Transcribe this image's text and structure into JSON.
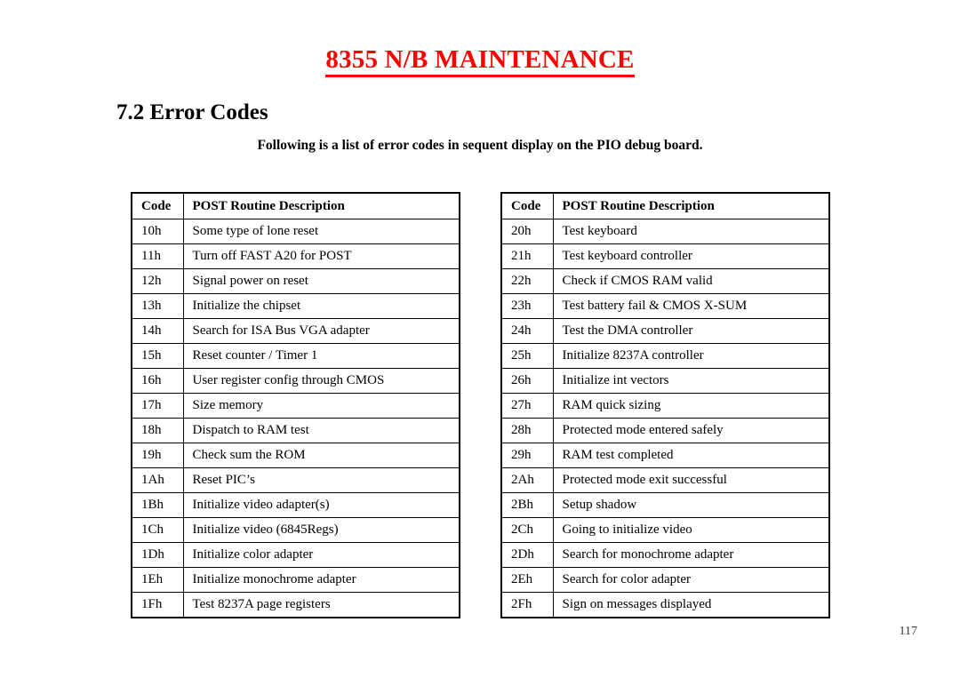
{
  "document": {
    "title": "8355 N/B MAINTENANCE",
    "title_color": "#ff0000",
    "section_heading": "7.2 Error Codes",
    "intro_text": "Following is a list of error codes in sequent display on the PIO debug board.",
    "page_number": "117"
  },
  "tables": {
    "left": {
      "headers": {
        "code": "Code",
        "description": "POST Routine Description"
      },
      "rows": [
        {
          "code": "10h",
          "description": "Some type of lone reset"
        },
        {
          "code": "11h",
          "description": "Turn off FAST A20 for POST"
        },
        {
          "code": "12h",
          "description": "Signal power on reset"
        },
        {
          "code": "13h",
          "description": "Initialize the chipset"
        },
        {
          "code": "14h",
          "description": "Search for ISA Bus VGA adapter"
        },
        {
          "code": "15h",
          "description": "Reset counter / Timer 1"
        },
        {
          "code": "16h",
          "description": "User register config through CMOS"
        },
        {
          "code": "17h",
          "description": "Size memory"
        },
        {
          "code": "18h",
          "description": "Dispatch to RAM test"
        },
        {
          "code": "19h",
          "description": "Check sum the ROM"
        },
        {
          "code": "1Ah",
          "description": "Reset PIC’s"
        },
        {
          "code": "1Bh",
          "description": "Initialize video adapter(s)"
        },
        {
          "code": "1Ch",
          "description": "Initialize video (6845Regs)"
        },
        {
          "code": "1Dh",
          "description": "Initialize color adapter"
        },
        {
          "code": "1Eh",
          "description": "Initialize monochrome adapter"
        },
        {
          "code": "1Fh",
          "description": "Test 8237A page registers"
        }
      ]
    },
    "right": {
      "headers": {
        "code": "Code",
        "description": "POST Routine Description"
      },
      "rows": [
        {
          "code": "20h",
          "description": "Test keyboard"
        },
        {
          "code": "21h",
          "description": "Test keyboard controller"
        },
        {
          "code": "22h",
          "description": "Check if CMOS RAM valid"
        },
        {
          "code": "23h",
          "description": "Test battery fail & CMOS X-SUM"
        },
        {
          "code": "24h",
          "description": "Test the DMA controller"
        },
        {
          "code": "25h",
          "description": "Initialize 8237A controller"
        },
        {
          "code": "26h",
          "description": "Initialize int vectors"
        },
        {
          "code": "27h",
          "description": "RAM quick sizing"
        },
        {
          "code": "28h",
          "description": "Protected mode entered safely"
        },
        {
          "code": "29h",
          "description": "RAM test completed"
        },
        {
          "code": "2Ah",
          "description": "Protected mode exit successful"
        },
        {
          "code": "2Bh",
          "description": "Setup shadow"
        },
        {
          "code": "2Ch",
          "description": "Going to initialize video"
        },
        {
          "code": "2Dh",
          "description": "Search for monochrome adapter"
        },
        {
          "code": "2Eh",
          "description": "Search for color adapter"
        },
        {
          "code": "2Fh",
          "description": "Sign on messages displayed"
        }
      ]
    }
  }
}
